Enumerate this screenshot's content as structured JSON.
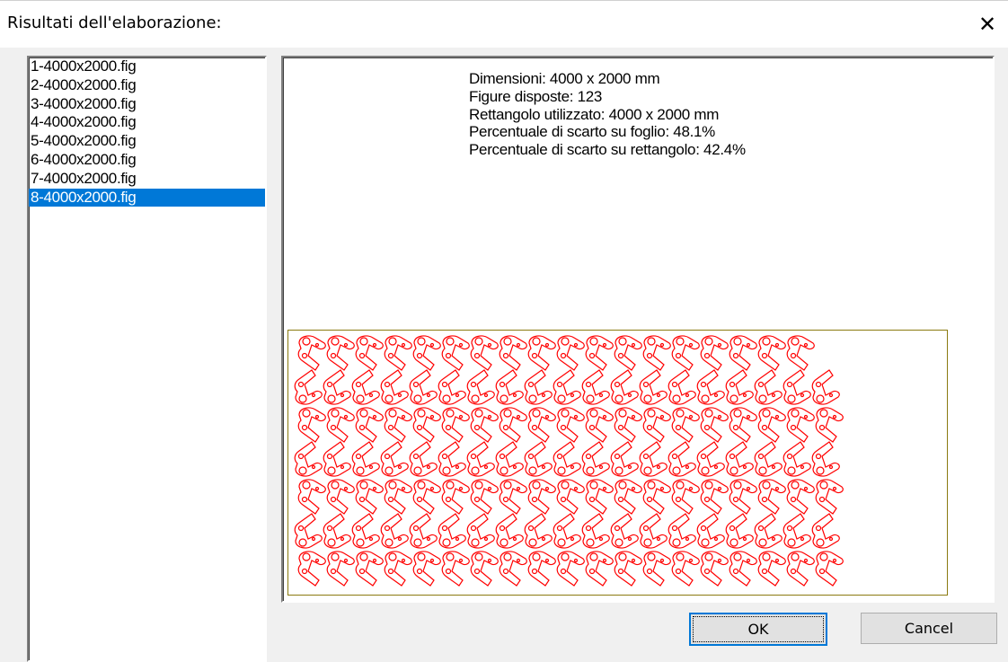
{
  "window": {
    "title": "Risultati dell'elaborazione:",
    "close_icon": "close-icon"
  },
  "files": {
    "items": [
      "1-4000x2000.fig",
      "2-4000x2000.fig",
      "3-4000x2000.fig",
      "4-4000x2000.fig",
      "5-4000x2000.fig",
      "6-4000x2000.fig",
      "7-4000x2000.fig",
      "8-4000x2000.fig"
    ],
    "selected_index": 7
  },
  "info": {
    "dimensions": "Dimensioni: 4000 x 2000 mm",
    "figures": "Figure disposte: 123",
    "rectangle": "Rettangolo utilizzato: 4000 x 2000 mm",
    "waste_sheet": "Percentuale di scarto su foglio: 48.1%",
    "waste_rectangle": "Percentuale di scarto su rettangolo: 42.4%"
  },
  "nesting": {
    "figure_color": "#ff0000",
    "sheet_border_color": "#8a7a10",
    "rows": [
      {
        "count": 18
      },
      {
        "count": 19
      },
      {
        "count": 19
      },
      {
        "count": 19
      },
      {
        "count": 19
      },
      {
        "count": 19
      },
      {
        "count": 19
      }
    ]
  },
  "buttons": {
    "ok": "OK",
    "cancel": "Cancel"
  }
}
